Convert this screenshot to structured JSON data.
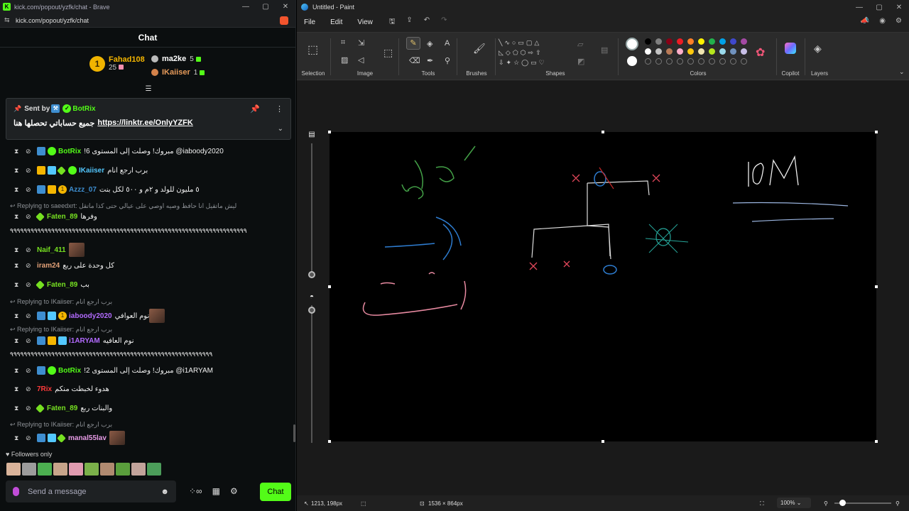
{
  "browser": {
    "title": "kick.com/popout/yzfk/chat - Brave",
    "url": "kick.com/popout/yzfk/chat",
    "window_controls": [
      "—",
      "▢",
      "✕"
    ]
  },
  "chat": {
    "header": "Chat",
    "leaderboard": {
      "first": {
        "rank": "1",
        "name": "Fahad108",
        "score": "25"
      },
      "second": {
        "name": "ma2ke",
        "score": "5"
      },
      "third": {
        "name": "IKaiiser",
        "score": "1"
      }
    },
    "pinned": {
      "sent_by_label": "Sent by",
      "sender": "BotRix",
      "message": "جميع حساباتي تحصلها هنا",
      "link": "https://linktr.ee/OnlyYZFK"
    },
    "messages": [
      {
        "user": "BotRix",
        "color": "#53fc18",
        "text": "!مبروك! وصلت إلى المستوى 6 @iaboody2020"
      },
      {
        "user": "IKaiiser",
        "color": "#53c8ff",
        "text": "برب ارجع انام"
      },
      {
        "user": "Azzz_07",
        "color": "#3e8ed0",
        "text": "٥ مليون للولد و ٢م و ٥٠٠ لكل بنت",
        "level": "1"
      },
      {
        "reply_label": "Replying to saeedxrt:",
        "reply_text": "ليش ماتقيل انا حافظ وصيه اوصي على عيالي حتى كذا ماتقل"
      },
      {
        "user": "Faten_89",
        "color": "#76e021",
        "text": "وفرها"
      },
      {
        "spam": "٩٩٩٩٩٩٩٩٩٩٩٩٩٩٩٩٩٩٩٩٩٩٩٩٩٩٩٩٩٩٩٩٩٩٩٩٩٩٩٩٩٩٩٩٩٩٩٩٩٩٩٩٩٩٩٩٩٩٩٩٩٩٩٩٩٩٩٩٩"
      },
      {
        "user": "Naif_411",
        "color": "#76e021",
        "text": ""
      },
      {
        "user": "iram24",
        "color": "#e3a178",
        "text": "كل وحدة على ربع"
      },
      {
        "user": "Faten_89",
        "color": "#76e021",
        "text": "بب"
      },
      {
        "reply_label": "Replying to IKaiiser:",
        "reply_text": "برب ارجع انام"
      },
      {
        "user": "iaboody2020",
        "color": "#b36bff",
        "text": "نوم العوافي",
        "level": "1"
      },
      {
        "reply_label": "Replying to IKaiiser:",
        "reply_text": "برب ارجع انام"
      },
      {
        "user": "i1ARYAM",
        "color": "#b36bff",
        "text": "نوم العافيه"
      },
      {
        "spam": "٩٩٩٩٩٩٩٩٩٩٩٩٩٩٩٩٩٩٩٩٩٩٩٩٩٩٩٩٩٩٩٩٩٩٩٩٩٩٩٩٩٩٩٩٩٩٩٩٩٩٩٩٩٩٩٩٩٩٩"
      },
      {
        "user": "BotRix",
        "color": "#53fc18",
        "text": "!مبروك! وصلت إلى المستوى 2 @i1ARYAM"
      },
      {
        "user": "7Rix",
        "color": "#ff3b3b",
        "text": "هدوء لخبطت منكم"
      },
      {
        "user": "Faten_89",
        "color": "#76e021",
        "text": "والبنات ربع"
      },
      {
        "reply_label": "Replying to IKaiiser:",
        "reply_text": "برب ارجع انام"
      },
      {
        "user": "manal55lav",
        "color": "#e79be6",
        "text": ""
      }
    ],
    "followers_only": "Followers only",
    "input_placeholder": "Send a message",
    "send_button": "Chat"
  },
  "paint": {
    "title": "Untitled - Paint",
    "menu": [
      "File",
      "Edit",
      "View"
    ],
    "groups": [
      "Selection",
      "Image",
      "Tools",
      "Brushes",
      "Shapes",
      "Colors",
      "Copilot",
      "Layers"
    ],
    "colors": {
      "primary": "#ffffff",
      "secondary": "#ffffff",
      "row1": [
        "#000000",
        "#7f7f7f",
        "#880015",
        "#ed1c24",
        "#ff7f27",
        "#fff200",
        "#22b14c",
        "#00a2e8",
        "#3f48cc",
        "#a349a4"
      ],
      "row2": [
        "#ffffff",
        "#c3c3c3",
        "#b97a57",
        "#ffaec9",
        "#ffc90e",
        "#efe4b0",
        "#b5e61d",
        "#99d9ea",
        "#7092be",
        "#c8bfe7"
      ]
    },
    "status": {
      "cursor": "1213, 198px",
      "canvas_size": "1536 × 864px",
      "zoom": "100%"
    }
  }
}
